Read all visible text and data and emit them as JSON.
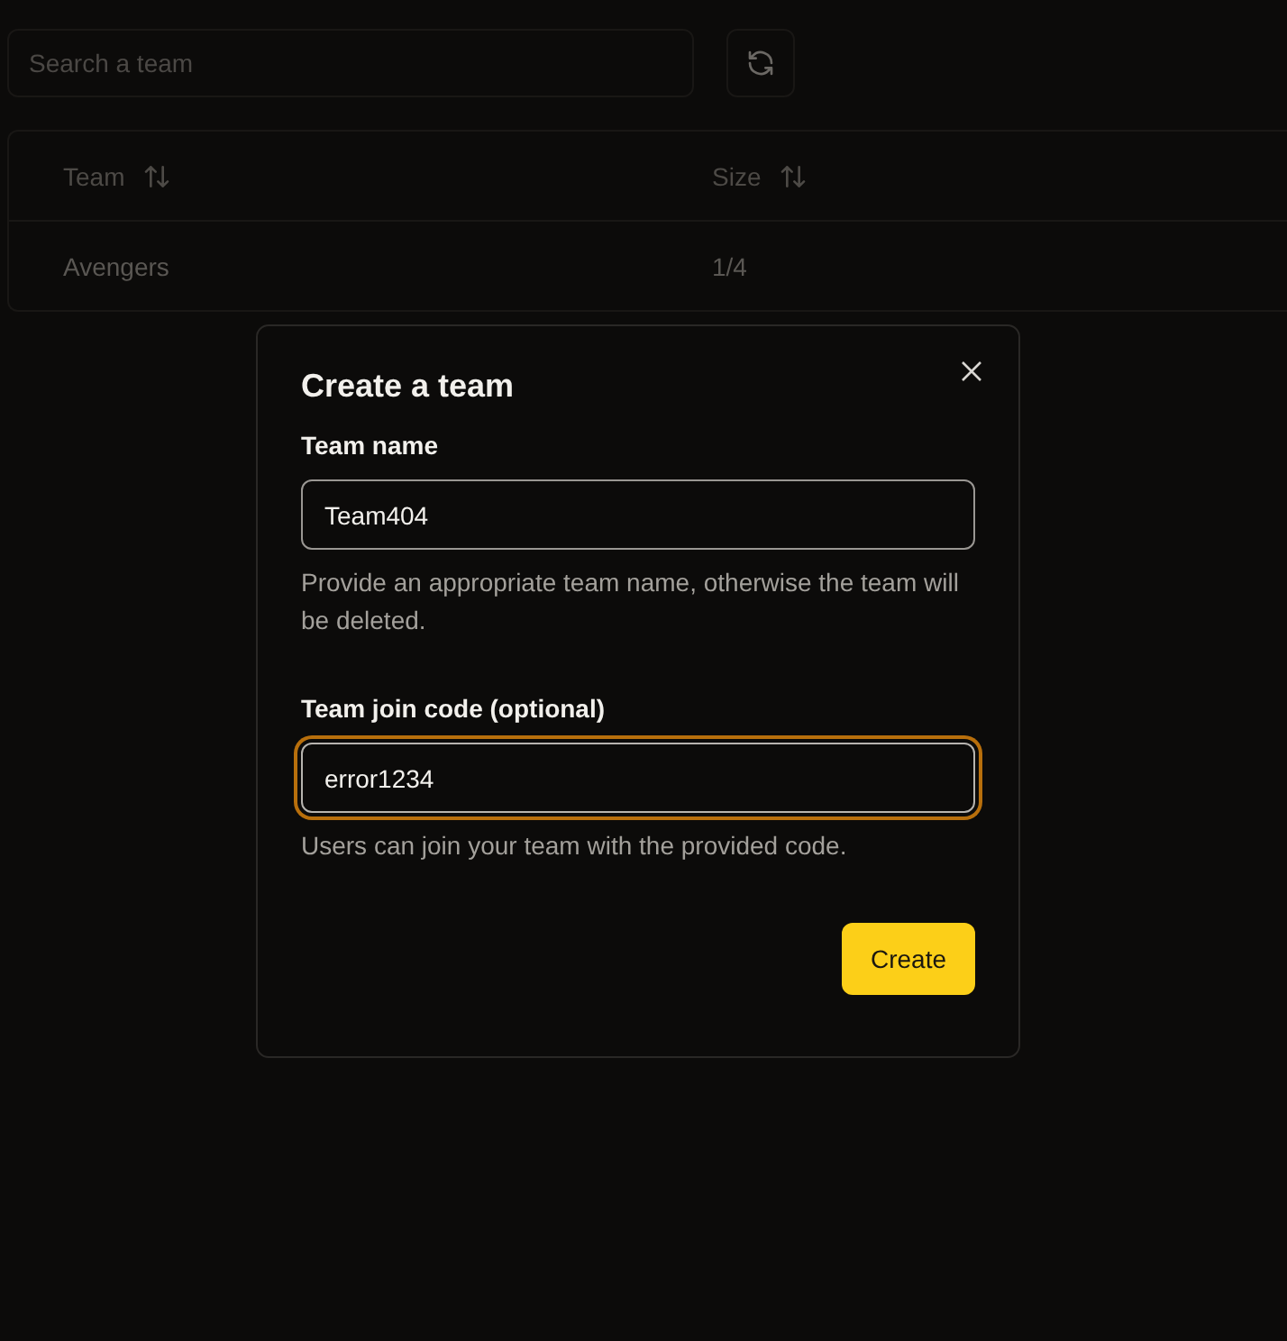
{
  "search": {
    "placeholder": "Search a team"
  },
  "table": {
    "columns": [
      {
        "label": "Team"
      },
      {
        "label": "Size"
      }
    ],
    "rows": [
      {
        "cells": [
          "Avengers",
          "1/4"
        ]
      }
    ]
  },
  "dialog": {
    "title": "Create a team",
    "fields": [
      {
        "label": "Team name",
        "value": "Team404",
        "help": "Provide an appropriate team name, otherwise the team will be deleted.",
        "focused": false
      },
      {
        "label": "Team join code (optional)",
        "value": "error1234",
        "help": "Users can join your team with the provided code.",
        "focused": true
      }
    ],
    "submit": "Create"
  }
}
